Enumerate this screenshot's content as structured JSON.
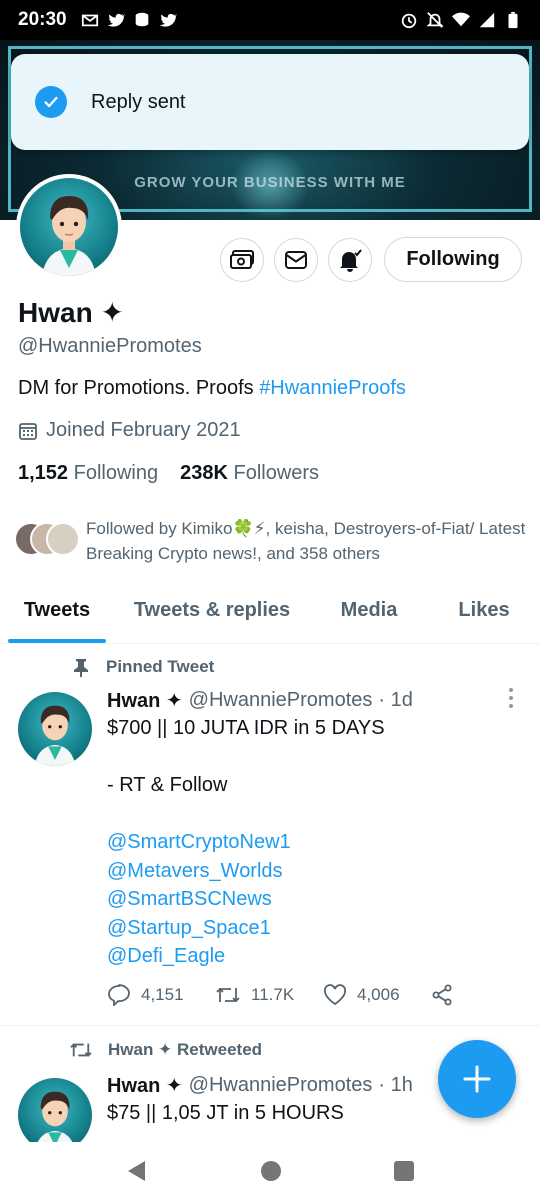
{
  "status_bar": {
    "time": "20:30",
    "left_icons": [
      "gmail-icon",
      "twitter-icon",
      "data-icon",
      "twitter-icon"
    ],
    "right_icons": [
      "alarm-icon",
      "mute-icon",
      "wifi-icon",
      "signal-icon",
      "battery-icon"
    ]
  },
  "banner": {
    "text": "GROW YOUR BUSINESS WITH ME"
  },
  "toast": {
    "message": "Reply sent"
  },
  "profile": {
    "name": "Hwan ✦",
    "handle": "@HwanniePromotes",
    "bio_text": "DM for Promotions. Proofs ",
    "bio_link": "#HwannieProofs",
    "joined": "Joined February 2021",
    "following_count": "1,152",
    "following_label": "Following",
    "followers_count": "238K",
    "followers_label": "Followers",
    "followed_by": "Followed by Kimiko🍀⚡, keisha, Destroyers-of-Fiat/ Latest Breaking Crypto news!, and 358 others",
    "follow_button": "Following"
  },
  "tabs": [
    {
      "label": "Tweets",
      "active": true
    },
    {
      "label": "Tweets & replies",
      "active": false
    },
    {
      "label": "Media",
      "active": false
    },
    {
      "label": "Likes",
      "active": false
    }
  ],
  "tweets": [
    {
      "context": "Pinned Tweet",
      "name": "Hwan ✦",
      "handle": "@HwanniePromotes",
      "time": "· 1d",
      "lines": [
        "$700 || 10 JUTA IDR in 5 DAYS",
        "",
        "- RT & Follow"
      ],
      "mentions": [
        "@SmartCryptoNew1",
        "@Metavers_Worlds",
        "@SmartBSCNews",
        "@Startup_Space1",
        "@Defi_Eagle"
      ],
      "replies": "4,151",
      "retweets": "11.7K",
      "likes": "4,006"
    },
    {
      "context": "Hwan ✦ Retweeted",
      "name": "Hwan ✦",
      "handle": "@HwanniePromotes",
      "time": "· 1h",
      "text": "$75 || 1,05 JT in 5 HOURS"
    }
  ],
  "colors": {
    "accent": "#1d9bf0",
    "text_primary": "#0f1419",
    "text_secondary": "#536471"
  }
}
